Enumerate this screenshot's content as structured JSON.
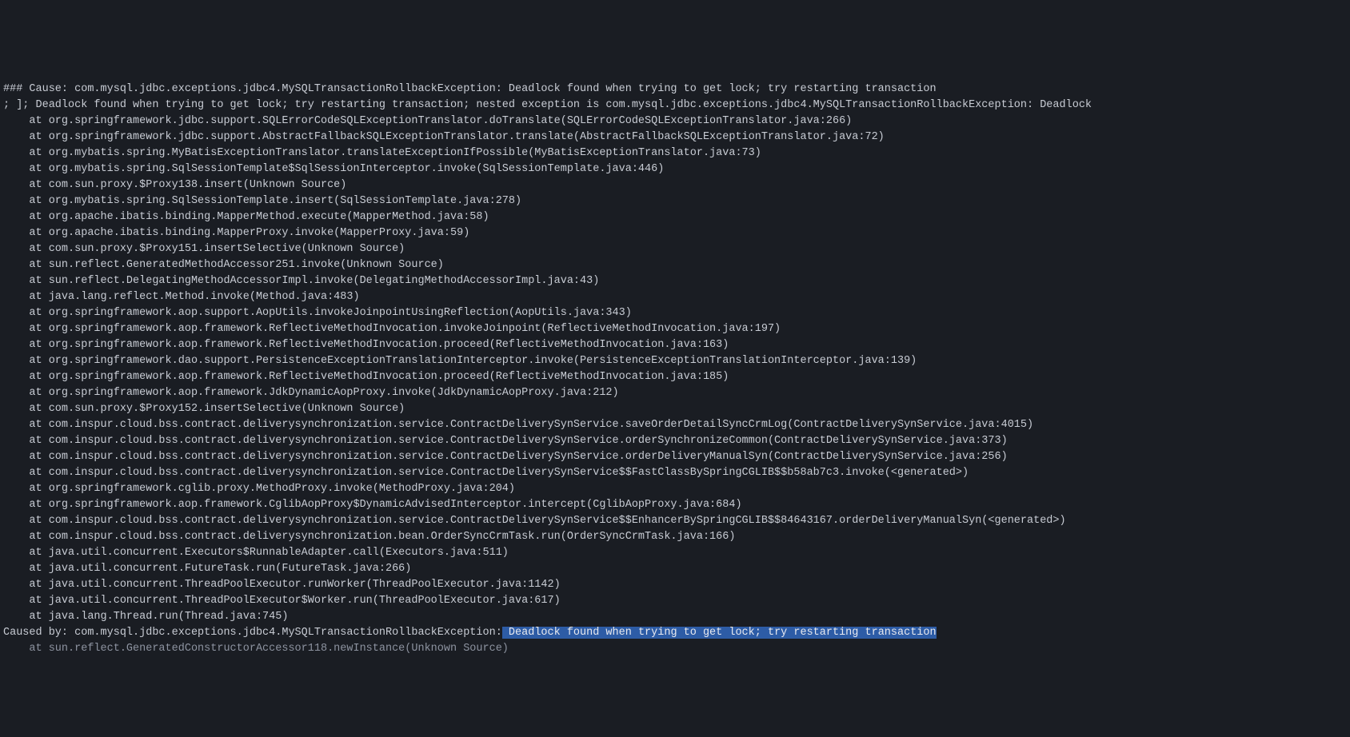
{
  "log": {
    "lines": [
      "### Cause: com.mysql.jdbc.exceptions.jdbc4.MySQLTransactionRollbackException: Deadlock found when trying to get lock; try restarting transaction",
      "; ]; Deadlock found when trying to get lock; try restarting transaction; nested exception is com.mysql.jdbc.exceptions.jdbc4.MySQLTransactionRollbackException: Deadlock",
      "    at org.springframework.jdbc.support.SQLErrorCodeSQLExceptionTranslator.doTranslate(SQLErrorCodeSQLExceptionTranslator.java:266)",
      "    at org.springframework.jdbc.support.AbstractFallbackSQLExceptionTranslator.translate(AbstractFallbackSQLExceptionTranslator.java:72)",
      "    at org.mybatis.spring.MyBatisExceptionTranslator.translateExceptionIfPossible(MyBatisExceptionTranslator.java:73)",
      "    at org.mybatis.spring.SqlSessionTemplate$SqlSessionInterceptor.invoke(SqlSessionTemplate.java:446)",
      "    at com.sun.proxy.$Proxy138.insert(Unknown Source)",
      "    at org.mybatis.spring.SqlSessionTemplate.insert(SqlSessionTemplate.java:278)",
      "    at org.apache.ibatis.binding.MapperMethod.execute(MapperMethod.java:58)",
      "    at org.apache.ibatis.binding.MapperProxy.invoke(MapperProxy.java:59)",
      "    at com.sun.proxy.$Proxy151.insertSelective(Unknown Source)",
      "    at sun.reflect.GeneratedMethodAccessor251.invoke(Unknown Source)",
      "    at sun.reflect.DelegatingMethodAccessorImpl.invoke(DelegatingMethodAccessorImpl.java:43)",
      "    at java.lang.reflect.Method.invoke(Method.java:483)",
      "    at org.springframework.aop.support.AopUtils.invokeJoinpointUsingReflection(AopUtils.java:343)",
      "    at org.springframework.aop.framework.ReflectiveMethodInvocation.invokeJoinpoint(ReflectiveMethodInvocation.java:197)",
      "    at org.springframework.aop.framework.ReflectiveMethodInvocation.proceed(ReflectiveMethodInvocation.java:163)",
      "    at org.springframework.dao.support.PersistenceExceptionTranslationInterceptor.invoke(PersistenceExceptionTranslationInterceptor.java:139)",
      "    at org.springframework.aop.framework.ReflectiveMethodInvocation.proceed(ReflectiveMethodInvocation.java:185)",
      "    at org.springframework.aop.framework.JdkDynamicAopProxy.invoke(JdkDynamicAopProxy.java:212)",
      "    at com.sun.proxy.$Proxy152.insertSelective(Unknown Source)",
      "    at com.inspur.cloud.bss.contract.deliverysynchronization.service.ContractDeliverySynService.saveOrderDetailSyncCrmLog(ContractDeliverySynService.java:4015)",
      "    at com.inspur.cloud.bss.contract.deliverysynchronization.service.ContractDeliverySynService.orderSynchronizeCommon(ContractDeliverySynService.java:373)",
      "    at com.inspur.cloud.bss.contract.deliverysynchronization.service.ContractDeliverySynService.orderDeliveryManualSyn(ContractDeliverySynService.java:256)",
      "    at com.inspur.cloud.bss.contract.deliverysynchronization.service.ContractDeliverySynService$$FastClassBySpringCGLIB$$b58ab7c3.invoke(<generated>)",
      "    at org.springframework.cglib.proxy.MethodProxy.invoke(MethodProxy.java:204)",
      "    at org.springframework.aop.framework.CglibAopProxy$DynamicAdvisedInterceptor.intercept(CglibAopProxy.java:684)",
      "    at com.inspur.cloud.bss.contract.deliverysynchronization.service.ContractDeliverySynService$$EnhancerBySpringCGLIB$$84643167.orderDeliveryManualSyn(<generated>)",
      "    at com.inspur.cloud.bss.contract.deliverysynchronization.bean.OrderSyncCrmTask.run(OrderSyncCrmTask.java:166)",
      "    at java.util.concurrent.Executors$RunnableAdapter.call(Executors.java:511)",
      "    at java.util.concurrent.FutureTask.run(FutureTask.java:266)",
      "    at java.util.concurrent.ThreadPoolExecutor.runWorker(ThreadPoolExecutor.java:1142)",
      "    at java.util.concurrent.ThreadPoolExecutor$Worker.run(ThreadPoolExecutor.java:617)",
      "    at java.lang.Thread.run(Thread.java:745)"
    ],
    "caused_by_prefix": "Caused by: com.mysql.jdbc.exceptions.jdbc4.MySQLTransactionRollbackException:",
    "caused_by_highlight": " Deadlock found when trying to get lock; try restarting transaction",
    "last_line": "    at sun.reflect.GeneratedConstructorAccessor118.newInstance(Unknown Source)"
  }
}
